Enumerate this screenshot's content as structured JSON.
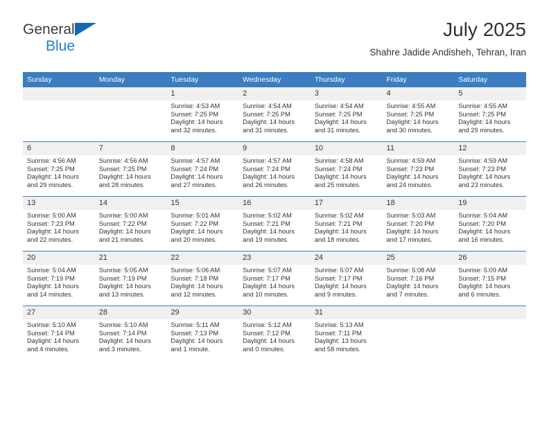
{
  "brand": {
    "name_part1": "General",
    "name_part2": "Blue",
    "accent_color": "#1c7fd0",
    "triangle_color": "#1569b2"
  },
  "header": {
    "title": "July 2025",
    "subtitle": "Shahre Jadide Andisheh, Tehran, Iran"
  },
  "theme": {
    "header_bg": "#3b7dc0",
    "daynum_bg": "#f0f0f0",
    "text_color": "#333333"
  },
  "weekday_headers": [
    "Sunday",
    "Monday",
    "Tuesday",
    "Wednesday",
    "Thursday",
    "Friday",
    "Saturday"
  ],
  "weeks": [
    [
      {
        "day": "",
        "empty": true,
        "sunrise": "",
        "sunset": "",
        "daylight_line1": "",
        "daylight_line2": ""
      },
      {
        "day": "",
        "empty": true,
        "sunrise": "",
        "sunset": "",
        "daylight_line1": "",
        "daylight_line2": ""
      },
      {
        "day": "1",
        "sunrise": "Sunrise: 4:53 AM",
        "sunset": "Sunset: 7:25 PM",
        "daylight_line1": "Daylight: 14 hours",
        "daylight_line2": "and 32 minutes."
      },
      {
        "day": "2",
        "sunrise": "Sunrise: 4:54 AM",
        "sunset": "Sunset: 7:25 PM",
        "daylight_line1": "Daylight: 14 hours",
        "daylight_line2": "and 31 minutes."
      },
      {
        "day": "3",
        "sunrise": "Sunrise: 4:54 AM",
        "sunset": "Sunset: 7:25 PM",
        "daylight_line1": "Daylight: 14 hours",
        "daylight_line2": "and 31 minutes."
      },
      {
        "day": "4",
        "sunrise": "Sunrise: 4:55 AM",
        "sunset": "Sunset: 7:25 PM",
        "daylight_line1": "Daylight: 14 hours",
        "daylight_line2": "and 30 minutes."
      },
      {
        "day": "5",
        "sunrise": "Sunrise: 4:55 AM",
        "sunset": "Sunset: 7:25 PM",
        "daylight_line1": "Daylight: 14 hours",
        "daylight_line2": "and 29 minutes."
      }
    ],
    [
      {
        "day": "6",
        "sunrise": "Sunrise: 4:56 AM",
        "sunset": "Sunset: 7:25 PM",
        "daylight_line1": "Daylight: 14 hours",
        "daylight_line2": "and 29 minutes."
      },
      {
        "day": "7",
        "sunrise": "Sunrise: 4:56 AM",
        "sunset": "Sunset: 7:25 PM",
        "daylight_line1": "Daylight: 14 hours",
        "daylight_line2": "and 28 minutes."
      },
      {
        "day": "8",
        "sunrise": "Sunrise: 4:57 AM",
        "sunset": "Sunset: 7:24 PM",
        "daylight_line1": "Daylight: 14 hours",
        "daylight_line2": "and 27 minutes."
      },
      {
        "day": "9",
        "sunrise": "Sunrise: 4:57 AM",
        "sunset": "Sunset: 7:24 PM",
        "daylight_line1": "Daylight: 14 hours",
        "daylight_line2": "and 26 minutes."
      },
      {
        "day": "10",
        "sunrise": "Sunrise: 4:58 AM",
        "sunset": "Sunset: 7:24 PM",
        "daylight_line1": "Daylight: 14 hours",
        "daylight_line2": "and 25 minutes."
      },
      {
        "day": "11",
        "sunrise": "Sunrise: 4:59 AM",
        "sunset": "Sunset: 7:23 PM",
        "daylight_line1": "Daylight: 14 hours",
        "daylight_line2": "and 24 minutes."
      },
      {
        "day": "12",
        "sunrise": "Sunrise: 4:59 AM",
        "sunset": "Sunset: 7:23 PM",
        "daylight_line1": "Daylight: 14 hours",
        "daylight_line2": "and 23 minutes."
      }
    ],
    [
      {
        "day": "13",
        "sunrise": "Sunrise: 5:00 AM",
        "sunset": "Sunset: 7:23 PM",
        "daylight_line1": "Daylight: 14 hours",
        "daylight_line2": "and 22 minutes."
      },
      {
        "day": "14",
        "sunrise": "Sunrise: 5:00 AM",
        "sunset": "Sunset: 7:22 PM",
        "daylight_line1": "Daylight: 14 hours",
        "daylight_line2": "and 21 minutes."
      },
      {
        "day": "15",
        "sunrise": "Sunrise: 5:01 AM",
        "sunset": "Sunset: 7:22 PM",
        "daylight_line1": "Daylight: 14 hours",
        "daylight_line2": "and 20 minutes."
      },
      {
        "day": "16",
        "sunrise": "Sunrise: 5:02 AM",
        "sunset": "Sunset: 7:21 PM",
        "daylight_line1": "Daylight: 14 hours",
        "daylight_line2": "and 19 minutes."
      },
      {
        "day": "17",
        "sunrise": "Sunrise: 5:02 AM",
        "sunset": "Sunset: 7:21 PM",
        "daylight_line1": "Daylight: 14 hours",
        "daylight_line2": "and 18 minutes."
      },
      {
        "day": "18",
        "sunrise": "Sunrise: 5:03 AM",
        "sunset": "Sunset: 7:20 PM",
        "daylight_line1": "Daylight: 14 hours",
        "daylight_line2": "and 17 minutes."
      },
      {
        "day": "19",
        "sunrise": "Sunrise: 5:04 AM",
        "sunset": "Sunset: 7:20 PM",
        "daylight_line1": "Daylight: 14 hours",
        "daylight_line2": "and 16 minutes."
      }
    ],
    [
      {
        "day": "20",
        "sunrise": "Sunrise: 5:04 AM",
        "sunset": "Sunset: 7:19 PM",
        "daylight_line1": "Daylight: 14 hours",
        "daylight_line2": "and 14 minutes."
      },
      {
        "day": "21",
        "sunrise": "Sunrise: 5:05 AM",
        "sunset": "Sunset: 7:19 PM",
        "daylight_line1": "Daylight: 14 hours",
        "daylight_line2": "and 13 minutes."
      },
      {
        "day": "22",
        "sunrise": "Sunrise: 5:06 AM",
        "sunset": "Sunset: 7:18 PM",
        "daylight_line1": "Daylight: 14 hours",
        "daylight_line2": "and 12 minutes."
      },
      {
        "day": "23",
        "sunrise": "Sunrise: 5:07 AM",
        "sunset": "Sunset: 7:17 PM",
        "daylight_line1": "Daylight: 14 hours",
        "daylight_line2": "and 10 minutes."
      },
      {
        "day": "24",
        "sunrise": "Sunrise: 5:07 AM",
        "sunset": "Sunset: 7:17 PM",
        "daylight_line1": "Daylight: 14 hours",
        "daylight_line2": "and 9 minutes."
      },
      {
        "day": "25",
        "sunrise": "Sunrise: 5:08 AM",
        "sunset": "Sunset: 7:16 PM",
        "daylight_line1": "Daylight: 14 hours",
        "daylight_line2": "and 7 minutes."
      },
      {
        "day": "26",
        "sunrise": "Sunrise: 5:09 AM",
        "sunset": "Sunset: 7:15 PM",
        "daylight_line1": "Daylight: 14 hours",
        "daylight_line2": "and 6 minutes."
      }
    ],
    [
      {
        "day": "27",
        "sunrise": "Sunrise: 5:10 AM",
        "sunset": "Sunset: 7:14 PM",
        "daylight_line1": "Daylight: 14 hours",
        "daylight_line2": "and 4 minutes."
      },
      {
        "day": "28",
        "sunrise": "Sunrise: 5:10 AM",
        "sunset": "Sunset: 7:14 PM",
        "daylight_line1": "Daylight: 14 hours",
        "daylight_line2": "and 3 minutes."
      },
      {
        "day": "29",
        "sunrise": "Sunrise: 5:11 AM",
        "sunset": "Sunset: 7:13 PM",
        "daylight_line1": "Daylight: 14 hours",
        "daylight_line2": "and 1 minute."
      },
      {
        "day": "30",
        "sunrise": "Sunrise: 5:12 AM",
        "sunset": "Sunset: 7:12 PM",
        "daylight_line1": "Daylight: 14 hours",
        "daylight_line2": "and 0 minutes."
      },
      {
        "day": "31",
        "sunrise": "Sunrise: 5:13 AM",
        "sunset": "Sunset: 7:11 PM",
        "daylight_line1": "Daylight: 13 hours",
        "daylight_line2": "and 58 minutes."
      },
      {
        "day": "",
        "empty": true,
        "sunrise": "",
        "sunset": "",
        "daylight_line1": "",
        "daylight_line2": ""
      },
      {
        "day": "",
        "empty": true,
        "sunrise": "",
        "sunset": "",
        "daylight_line1": "",
        "daylight_line2": ""
      }
    ]
  ]
}
